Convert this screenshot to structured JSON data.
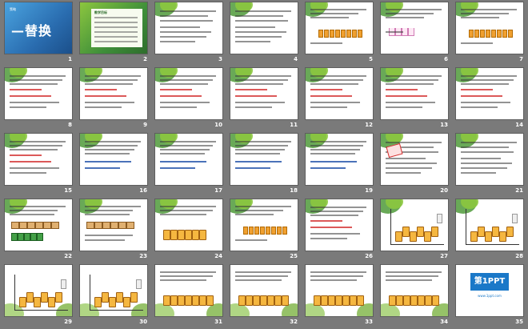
{
  "slides": [
    {
      "n": "1",
      "kind": "cover",
      "title": "策略",
      "subtitle": "—替换"
    },
    {
      "n": "2",
      "kind": "green",
      "label": "教学目标"
    },
    {
      "n": "3",
      "kind": "text"
    },
    {
      "n": "4",
      "kind": "text"
    },
    {
      "n": "5",
      "kind": "cups"
    },
    {
      "n": "6",
      "kind": "glasses"
    },
    {
      "n": "7",
      "kind": "cups"
    },
    {
      "n": "8",
      "kind": "text-red"
    },
    {
      "n": "9",
      "kind": "text-red"
    },
    {
      "n": "10",
      "kind": "text-red"
    },
    {
      "n": "11",
      "kind": "text-red"
    },
    {
      "n": "12",
      "kind": "text-red"
    },
    {
      "n": "13",
      "kind": "text-red"
    },
    {
      "n": "14",
      "kind": "text-red"
    },
    {
      "n": "15",
      "kind": "text-red"
    },
    {
      "n": "16",
      "kind": "text-blue"
    },
    {
      "n": "17",
      "kind": "text-blue"
    },
    {
      "n": "18",
      "kind": "text-blue"
    },
    {
      "n": "19",
      "kind": "text-blue"
    },
    {
      "n": "20",
      "kind": "diagram"
    },
    {
      "n": "21",
      "kind": "text"
    },
    {
      "n": "22",
      "kind": "boxes"
    },
    {
      "n": "23",
      "kind": "boxes2"
    },
    {
      "n": "24",
      "kind": "jars"
    },
    {
      "n": "25",
      "kind": "cups"
    },
    {
      "n": "26",
      "kind": "text-red"
    },
    {
      "n": "27",
      "kind": "chart"
    },
    {
      "n": "28",
      "kind": "chart"
    },
    {
      "n": "29",
      "kind": "chart-green"
    },
    {
      "n": "30",
      "kind": "chart-green"
    },
    {
      "n": "31",
      "kind": "green-jars"
    },
    {
      "n": "32",
      "kind": "green-jars"
    },
    {
      "n": "33",
      "kind": "green-jars"
    },
    {
      "n": "34",
      "kind": "green-jars"
    },
    {
      "n": "35",
      "kind": "logo",
      "logo": "第1PPT",
      "logo_sub": "www.1ppt.com"
    }
  ]
}
